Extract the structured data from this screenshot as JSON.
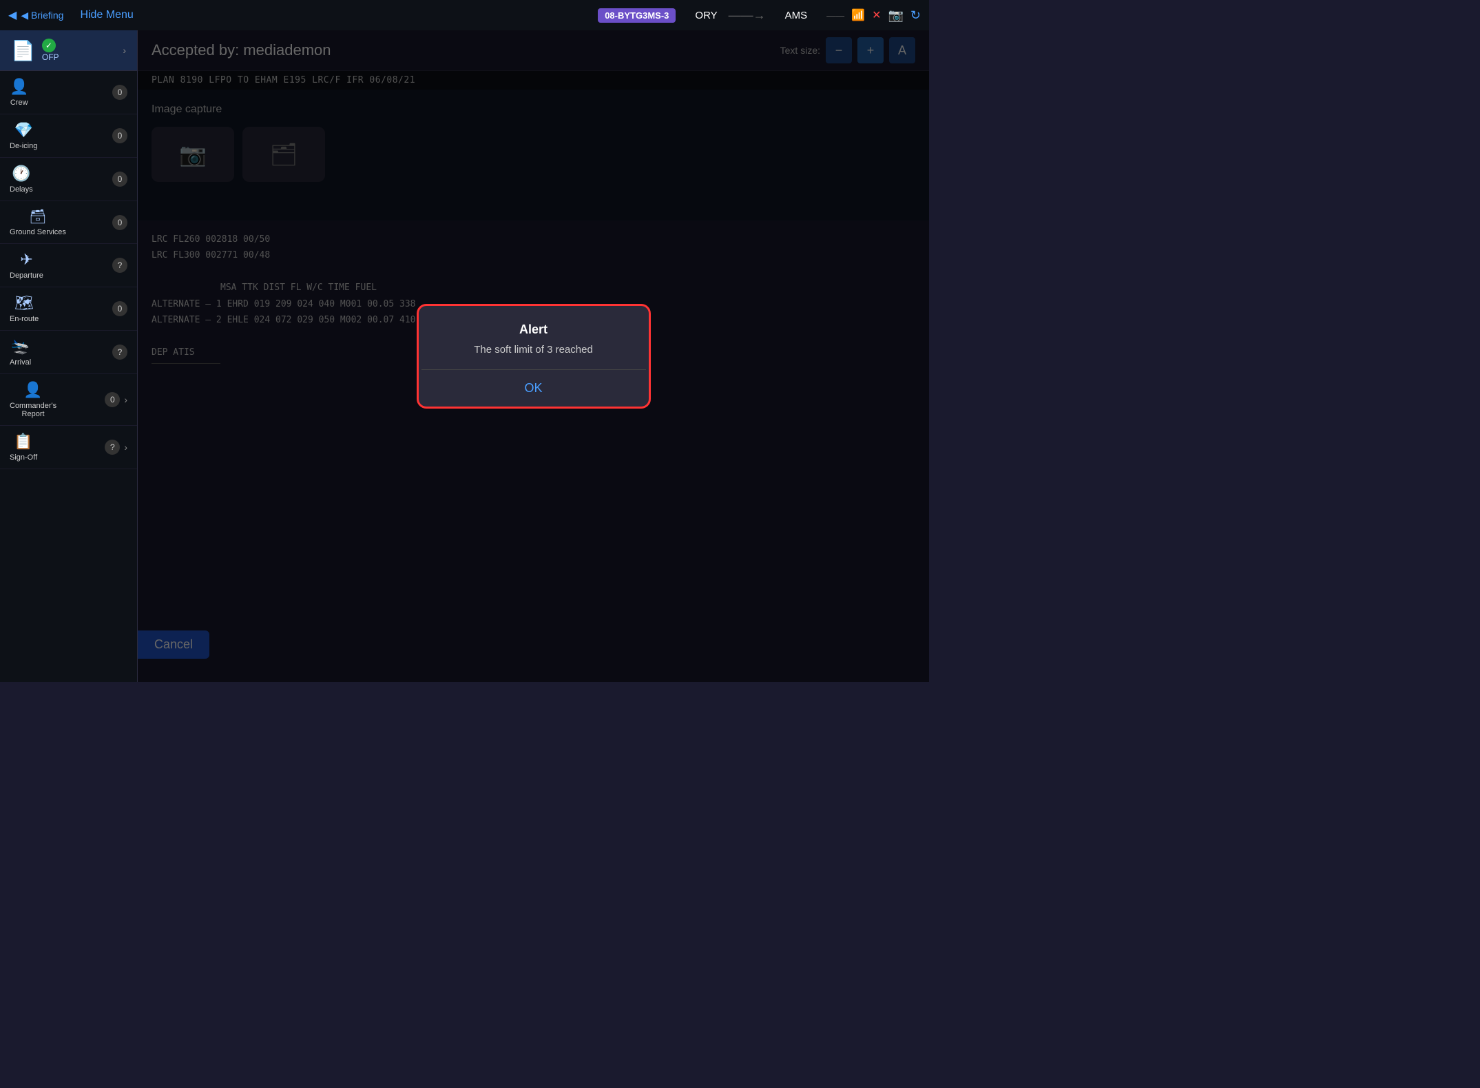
{
  "topNav": {
    "back_label": "◀ Briefing",
    "hide_menu_label": "Hide Menu",
    "flight_badge": "08-BYTG3MS-3",
    "origin": "ORY",
    "arrow": "——→",
    "destination": "AMS",
    "status_indicator": "●",
    "icons": [
      "📷",
      "↗",
      "✕",
      "↻"
    ]
  },
  "sidebar": {
    "active_item": {
      "icon": "📄",
      "check": "✓",
      "label": "OFP"
    },
    "chevron": "›",
    "items": [
      {
        "id": "crew",
        "icon": "👤",
        "label": "Crew",
        "badge": "0",
        "has_chevron": false
      },
      {
        "id": "de-icing",
        "icon": "💎",
        "label": "De-icing",
        "badge": "0",
        "has_chevron": false
      },
      {
        "id": "delays",
        "icon": "🕐",
        "label": "Delays",
        "badge": "0",
        "has_chevron": false
      },
      {
        "id": "ground-services",
        "icon": "🗃",
        "label": "Ground Services",
        "badge": "0",
        "has_chevron": false
      },
      {
        "id": "departure",
        "icon": "✈",
        "label": "Departure",
        "badge": "?",
        "has_chevron": false
      },
      {
        "id": "en-route",
        "icon": "🗺",
        "label": "En-route",
        "badge": "0",
        "has_chevron": false
      },
      {
        "id": "arrival",
        "icon": "🛬",
        "label": "Arrival",
        "badge": "?",
        "has_chevron": false
      },
      {
        "id": "commanders-report",
        "icon": "👤",
        "label": "Commander's Report",
        "badge": "0",
        "has_chevron": true
      },
      {
        "id": "sign-off",
        "icon": "📋",
        "label": "Sign-Off",
        "badge": "?",
        "has_chevron": true
      }
    ]
  },
  "header": {
    "accepted_by": "Accepted by: mediademon",
    "text_size_label": "Text size:",
    "minus_label": "−",
    "plus_label": "+",
    "third_btn_label": "A"
  },
  "plan_info": "PLAN 8190          LFPO TO EHAM E195   LRC/F  IFR  06/08/21",
  "image_capture": {
    "title": "Image capture",
    "camera_icon": "📷",
    "folder_icon": "🗂"
  },
  "cancel_btn": "Cancel",
  "flight_data": {
    "lines": [
      "    LRC  FL260  002818  00/50",
      "    LRC  FL300  002771  00/48",
      "",
      "              MSA   TTK   DIST   FL    W/C   TIME  FUEL",
      "ALTERNATE – 1  EHRD   019  209    024   040   M001  00.05  338",
      "ALTERNATE – 2  EHLE   024  072    029   050   M002  00.07  410",
      "",
      "DEP ATIS"
    ]
  },
  "alert": {
    "title": "Alert",
    "message": "The soft limit of 3 reached",
    "ok_label": "OK"
  }
}
